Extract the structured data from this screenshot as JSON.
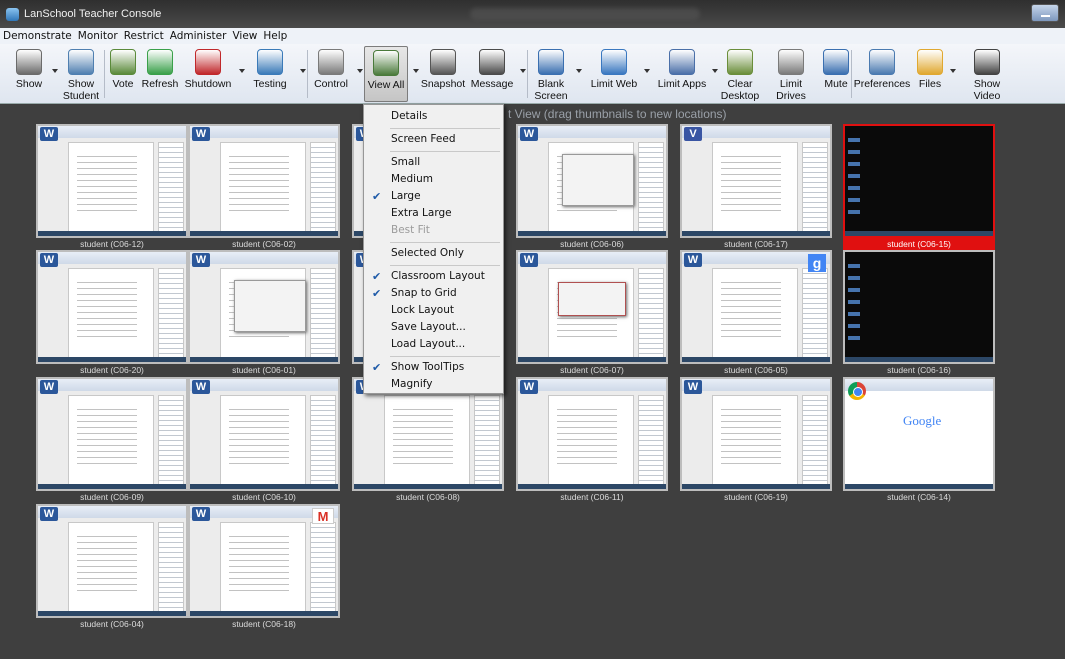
{
  "window": {
    "title": "LanSchool Teacher Console"
  },
  "menubar": [
    "Demonstrate",
    "Monitor",
    "Restrict",
    "Administer",
    "View",
    "Help"
  ],
  "toolbar": [
    {
      "id": "show",
      "label": "Show",
      "icon": "presenter-icon",
      "dropdown": true
    },
    {
      "id": "show-student",
      "label": "Show\nStudent",
      "icon": "student-presenter-icon",
      "dropdown": false
    },
    {
      "id": "vote",
      "label": "Vote",
      "icon": "vote-icon",
      "dropdown": false
    },
    {
      "id": "refresh",
      "label": "Refresh",
      "icon": "refresh-icon",
      "dropdown": false
    },
    {
      "id": "shutdown",
      "label": "Shutdown",
      "icon": "power-icon",
      "dropdown": true
    },
    {
      "id": "testing",
      "label": "Testing",
      "icon": "clipboard-icon",
      "dropdown": true
    },
    {
      "id": "control",
      "label": "Control",
      "icon": "pen-icon",
      "dropdown": true
    },
    {
      "id": "view-all",
      "label": "View All",
      "icon": "thumbnails-icon",
      "dropdown": true
    },
    {
      "id": "snapshot",
      "label": "Snapshot",
      "icon": "camera-icon",
      "dropdown": false
    },
    {
      "id": "message",
      "label": "Message",
      "icon": "message-icon",
      "dropdown": true
    },
    {
      "id": "blank-screen",
      "label": "Blank\nScreen",
      "icon": "blank-screen-icon",
      "dropdown": true
    },
    {
      "id": "limit-web",
      "label": "Limit Web",
      "icon": "globe-block-icon",
      "dropdown": true
    },
    {
      "id": "limit-apps",
      "label": "Limit Apps",
      "icon": "apps-block-icon",
      "dropdown": true
    },
    {
      "id": "clear-desktop",
      "label": "Clear\nDesktop",
      "icon": "broom-icon",
      "dropdown": false
    },
    {
      "id": "limit-drives",
      "label": "Limit Drives",
      "icon": "drive-block-icon",
      "dropdown": false
    },
    {
      "id": "mute",
      "label": "Mute",
      "icon": "speaker-icon",
      "dropdown": false
    },
    {
      "id": "preferences",
      "label": "Preferences",
      "icon": "gears-icon",
      "dropdown": false
    },
    {
      "id": "files",
      "label": "Files",
      "icon": "folder-icon",
      "dropdown": true
    },
    {
      "id": "show-video",
      "label": "Show Video",
      "icon": "film-icon",
      "dropdown": false
    }
  ],
  "workspace_caption": "t View (drag thumbnails to new locations)",
  "view_menu": [
    {
      "label": "Details",
      "checked": false,
      "disabled": false
    },
    {
      "sep": true
    },
    {
      "label": "Screen Feed",
      "checked": false,
      "disabled": false
    },
    {
      "sep": true
    },
    {
      "label": "Small",
      "checked": false,
      "disabled": false
    },
    {
      "label": "Medium",
      "checked": false,
      "disabled": false
    },
    {
      "label": "Large",
      "checked": true,
      "disabled": false
    },
    {
      "label": "Extra Large",
      "checked": false,
      "disabled": false
    },
    {
      "label": "Best Fit",
      "checked": false,
      "disabled": true
    },
    {
      "sep": true
    },
    {
      "label": "Selected Only",
      "checked": false,
      "disabled": false
    },
    {
      "sep": true
    },
    {
      "label": "Classroom Layout",
      "checked": true,
      "disabled": false
    },
    {
      "label": "Snap to Grid",
      "checked": true,
      "disabled": false
    },
    {
      "label": "Lock Layout",
      "checked": false,
      "disabled": false
    },
    {
      "label": "Save Layout...",
      "checked": false,
      "disabled": false
    },
    {
      "label": "Load Layout...",
      "checked": false,
      "disabled": false
    },
    {
      "sep": true
    },
    {
      "label": "Show ToolTips",
      "checked": true,
      "disabled": false
    },
    {
      "label": "Magnify",
      "checked": false,
      "disabled": false
    }
  ],
  "students": [
    {
      "label": "student (C06-12)",
      "type": "word",
      "selected": false
    },
    {
      "label": "student (C06-02)",
      "type": "word",
      "selected": false
    },
    {
      "label": "",
      "type": "word",
      "selected": false
    },
    {
      "label": "student (C06-06)",
      "type": "word-dialog",
      "selected": false
    },
    {
      "label": "student (C06-17)",
      "type": "visio",
      "selected": false
    },
    {
      "label": "student (C06-15)",
      "type": "desktop",
      "selected": true
    },
    {
      "label": "student (C06-20)",
      "type": "word",
      "selected": false
    },
    {
      "label": "student (C06-01)",
      "type": "word-dialog",
      "selected": false
    },
    {
      "label": "",
      "type": "word",
      "selected": false
    },
    {
      "label": "student (C06-07)",
      "type": "word-center",
      "selected": false
    },
    {
      "label": "student (C06-05)",
      "type": "word-gplus",
      "selected": false
    },
    {
      "label": "student (C06-16)",
      "type": "desktop",
      "selected": false
    },
    {
      "label": "student (C06-09)",
      "type": "word",
      "selected": false
    },
    {
      "label": "student (C06-10)",
      "type": "word",
      "selected": false
    },
    {
      "label": "student (C06-08)",
      "type": "word",
      "selected": false
    },
    {
      "label": "student (C06-11)",
      "type": "word",
      "selected": false
    },
    {
      "label": "student (C06-19)",
      "type": "word",
      "selected": false
    },
    {
      "label": "student (C06-14)",
      "type": "chrome",
      "selected": false
    },
    {
      "label": "student (C06-04)",
      "type": "word",
      "selected": false
    },
    {
      "label": "student (C06-18)",
      "type": "word-gmail",
      "selected": false
    }
  ],
  "google_logo_text": "Google",
  "gmail_logo_text": "M",
  "gplus_text": "g",
  "word_logo_text": "W",
  "visio_logo_text": "V"
}
